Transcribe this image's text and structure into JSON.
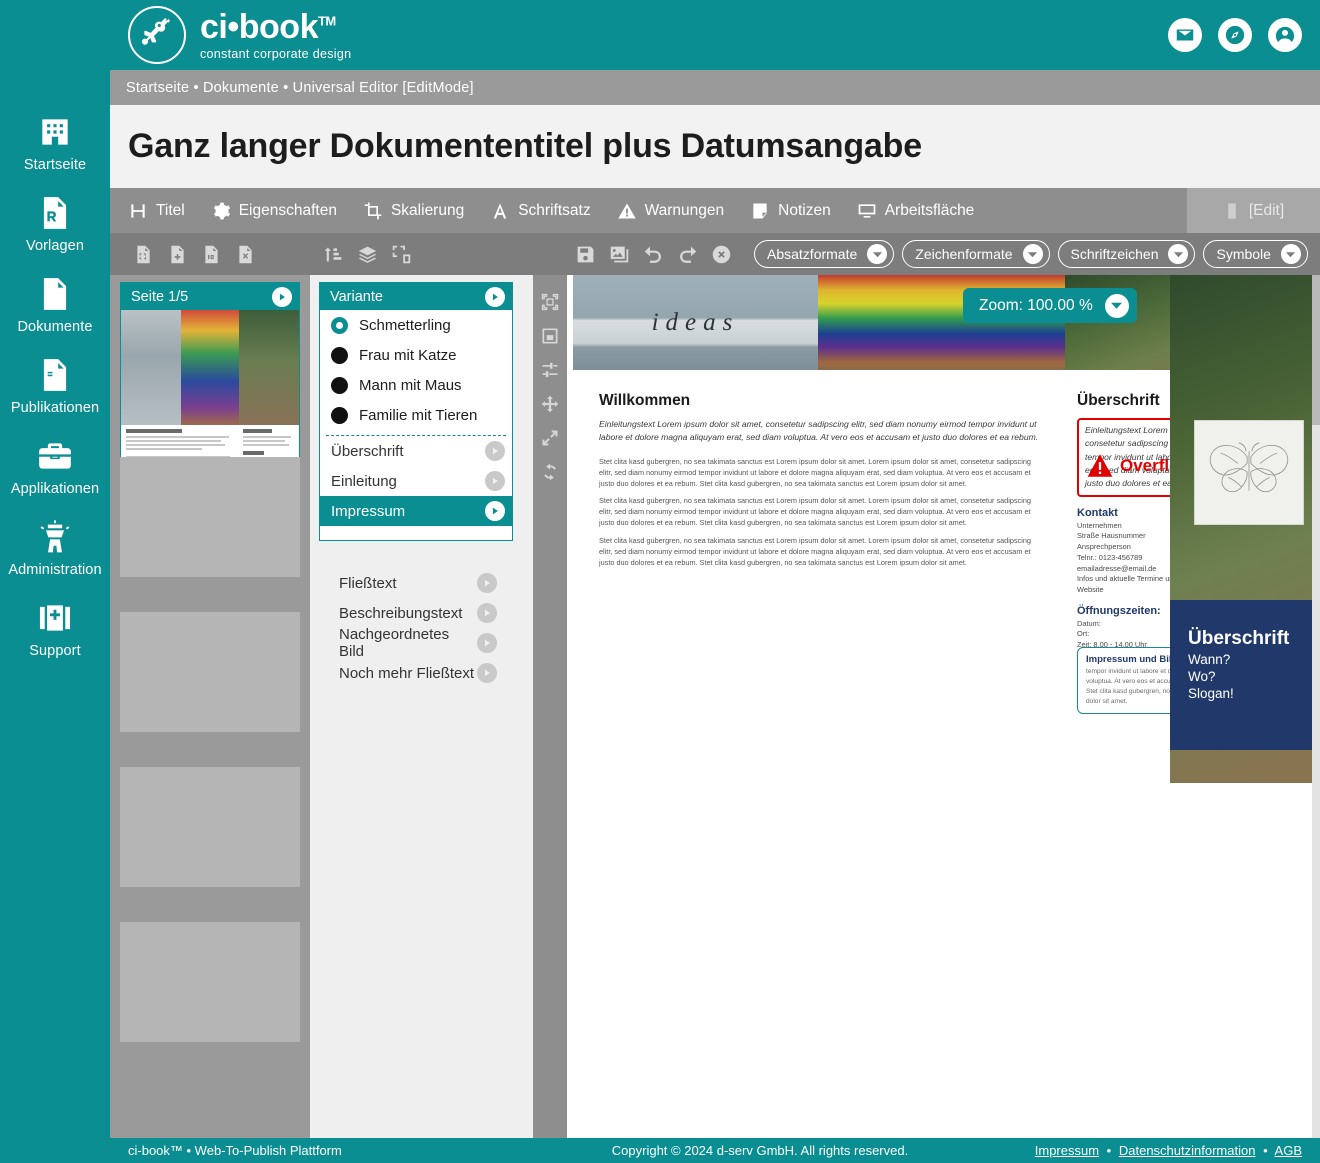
{
  "brand": {
    "name": "ci•book",
    "tm": "TM",
    "tagline": "constant corporate design",
    "logo_icon": "fairy-logo-icon"
  },
  "header": {
    "actions": [
      {
        "name": "mail-icon",
        "label": "Nachrichten"
      },
      {
        "name": "compass-icon",
        "label": "Entdecken"
      },
      {
        "name": "user-icon",
        "label": "Benutzerkonto"
      }
    ]
  },
  "sidebar": {
    "items": [
      {
        "label": "Startseite",
        "icon": "building-icon"
      },
      {
        "label": "Vorlagen",
        "icon": "prescription-document-icon"
      },
      {
        "label": "Dokumente",
        "icon": "code-document-icon"
      },
      {
        "label": "Publikationen",
        "icon": "flask-document-icon"
      },
      {
        "label": "Applikationen",
        "icon": "toolbox-icon"
      },
      {
        "label": "Administration",
        "icon": "control-tower-icon"
      },
      {
        "label": "Support",
        "icon": "first-aid-kit-icon"
      }
    ]
  },
  "breadcrumb": {
    "text": "Startseite • Dokumente • Universal Editor [EditMode]"
  },
  "document": {
    "title": "Ganz langer Dokumententitel plus Datumsangabe"
  },
  "tabs": [
    {
      "label": "Titel",
      "icon": "heading-icon"
    },
    {
      "label": "Eigenschaften",
      "icon": "gear-icon"
    },
    {
      "label": "Skalierung",
      "icon": "crop-icon"
    },
    {
      "label": "Schriftsatz",
      "icon": "font-a-icon"
    },
    {
      "label": "Warnungen",
      "icon": "warning-triangle-icon"
    },
    {
      "label": "Notizen",
      "icon": "note-icon"
    },
    {
      "label": "Arbeitsfläche",
      "icon": "monitor-icon"
    }
  ],
  "edit_tab": {
    "label": "[Edit]",
    "icon": "mobile-edit-icon"
  },
  "toolbar": {
    "left_buttons": [
      {
        "name": "document-frame-icon",
        "label": "Dokumentrahmen"
      },
      {
        "name": "document-add-icon",
        "label": "Seite hinzufügen"
      },
      {
        "name": "document-number-icon",
        "label": "Seitennummer"
      },
      {
        "name": "document-delete-icon",
        "label": "Seite löschen"
      }
    ],
    "mid_buttons": [
      {
        "name": "sort-order-icon",
        "label": "Reihenfolge"
      },
      {
        "name": "layers-icon",
        "label": "Ebenen"
      },
      {
        "name": "group-objects-icon",
        "label": "Gruppieren"
      }
    ],
    "right_buttons": [
      {
        "name": "save-icon",
        "label": "Speichern"
      },
      {
        "name": "images-icon",
        "label": "Bilder"
      },
      {
        "name": "undo-icon",
        "label": "Rückgängig"
      },
      {
        "name": "redo-icon",
        "label": "Wiederholen"
      },
      {
        "name": "close-circle-icon",
        "label": "Schließen"
      }
    ],
    "combos": [
      {
        "label": "Absatzformate"
      },
      {
        "label": "Zeichenformate"
      },
      {
        "label": "Schriftzeichen"
      },
      {
        "label": "Symbole"
      }
    ]
  },
  "vertical_strip": [
    {
      "name": "select-frame-icon",
      "label": "Rahmen auswählen"
    },
    {
      "name": "fit-frame-icon",
      "label": "Rahmen anpassen"
    },
    {
      "name": "sliders-icon",
      "label": "Einstellungen"
    },
    {
      "name": "move-icon",
      "label": "Verschieben"
    },
    {
      "name": "resize-diagonal-icon",
      "label": "Größe ändern"
    },
    {
      "name": "refresh-icon",
      "label": "Aktualisieren"
    }
  ],
  "pages_panel": {
    "card_title": "Seite 1/5",
    "placeholder_count": 4
  },
  "variant_panel": {
    "card_title": "Variante",
    "options": [
      {
        "label": "Schmetterling",
        "selected": true
      },
      {
        "label": "Frau mit Katze",
        "selected": false
      },
      {
        "label": "Mann mit Maus",
        "selected": false
      },
      {
        "label": "Familie mit Tieren",
        "selected": false
      }
    ],
    "rows": [
      {
        "label": "Überschrift",
        "selected": false
      },
      {
        "label": "Einleitung",
        "selected": false
      },
      {
        "label": "Impressum",
        "selected": true
      }
    ],
    "outer_rows": [
      {
        "label": "Fließtext"
      },
      {
        "label": "Beschreibungstext"
      },
      {
        "label": "Nachgeordnetes Bild"
      },
      {
        "label": "Noch mehr Fließtext"
      }
    ]
  },
  "preview": {
    "zoom_label": "Zoom: 100.00 %",
    "image_ideas_text": "ideas",
    "left_column": {
      "heading": "Willkommen",
      "lead": "Einleitungstext Lorem ipsum dolor sit amet, consetetur sadipscing elitr, sed diam nonumy eirmod tempor invidunt ut labore et dolore magna aliquyam erat, sed diam voluptua. At vero eos et accusam et justo duo dolores et ea rebum.",
      "paragraphs": [
        "Stet clita kasd gubergren, no sea takimata sanctus est Lorem ipsum dolor sit amet. Lorem ipsum dolor sit amet, consetetur sadipscing elitr, sed diam nonumy eirmod tempor invidunt ut labore et dolore magna aliquyam erat, sed diam voluptua. At vero eos et accusam et justo duo dolores et ea rebum. Stet clita kasd gubergren, no sea takimata sanctus est Lorem ipsum dolor sit amet.",
        "Stet clita kasd gubergren, no sea takimata sanctus est Lorem ipsum dolor sit amet. Lorem ipsum dolor sit amet, consetetur sadipscing elitr, sed diam nonumy eirmod tempor invidunt ut labore et dolore magna aliquyam erat, sed diam voluptua. At vero eos et accusam et justo duo dolores et ea rebum. Stet clita kasd gubergren, no sea takimata sanctus est Lorem ipsum dolor sit amet.",
        "Stet clita kasd gubergren, no sea takimata sanctus est Lorem ipsum dolor sit amet. Lorem ipsum dolor sit amet, consetetur sadipscing elitr, sed diam nonumy eirmod tempor invidunt ut labore et dolore magna aliquyam erat, sed diam voluptua. At vero eos et accusam et justo duo dolores et ea rebum. Stet clita kasd gubergren, no sea takimata sanctus est Lorem ipsum dolor sit amet."
      ]
    },
    "right_column": {
      "heading": "Überschrift",
      "overflow_text": "Einleitungstext Lorem ipsum dolor sit amet, consetetur sadipscing elitr, sed diam nonumy eirmod tempor invidunt ut labore et dolore magna aliquyam erat, sed diam voluptua. At vero eos et accusam et justo duo dolores et ea rebum.",
      "overflow_badge": "Overflow",
      "kontakt_heading": "Kontakt",
      "kontakt_lines": [
        "Unternehmen",
        "Straße Hausnummer",
        "Ansprechperson",
        "Telnr.: 0123-456789",
        "emailadresse@email.de",
        "Infos und aktuelle Termine unter:",
        "Website"
      ],
      "oeffnung_heading": "Öffnungszeiten:",
      "oeffnung_lines": [
        "Datum:",
        "Ort:",
        "Zeit: 8.00 - 14.00 Uhr"
      ],
      "impressum_heading": "Impressum und Bildnachweise:",
      "impressum_text": "tempor invidunt ut labore et dolore magna aliquyam erat, sed diam voluptua. At vero eos et accusam et justo duo dolores et ea rebum. Stet clita kasd gubergren, no sea takimata sanctus est Lorem ipsum dolor sit amet."
    },
    "navy_block": {
      "heading": "Überschrift",
      "line1": "Wann?",
      "line2": "Wo?",
      "line3": "Slogan!"
    }
  },
  "footer": {
    "left": "ci-book™ • Web-To-Publish Plattform",
    "center": "Copyright © 2024 d-serv GmbH. All rights reserved.",
    "links": [
      "Impressum",
      "Datenschutzinformation",
      "AGB"
    ],
    "separator": "•"
  },
  "colors": {
    "brand_teal": "#0b8e92",
    "toolbar_gray": "#7d7d7d",
    "tabbar_gray": "#8e8e8e",
    "panel_gray": "#9a9a9a",
    "navy": "#21386b",
    "overflow_red": "#e00000"
  }
}
